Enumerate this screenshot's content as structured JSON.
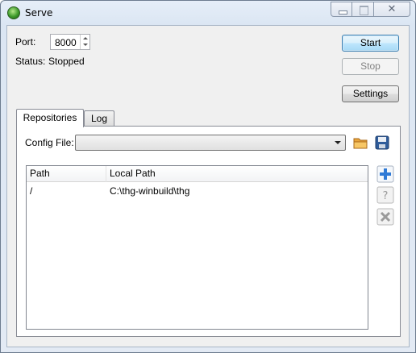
{
  "window": {
    "title": "Serve"
  },
  "server": {
    "port_label": "Port:",
    "port_value": "8000",
    "status_label": "Status:",
    "status_value": "Stopped"
  },
  "buttons": {
    "start": "Start",
    "stop": "Stop",
    "settings": "Settings"
  },
  "tabs": [
    {
      "label": "Repositories",
      "active": true
    },
    {
      "label": "Log",
      "active": false
    }
  ],
  "repositories": {
    "config_file_label": "Config File:",
    "config_file_value": "",
    "columns": [
      "Path",
      "Local Path"
    ],
    "rows": [
      {
        "path": "/",
        "local_path": "C:\\thg-winbuild\\thg"
      }
    ]
  },
  "icons": {
    "open": "folder-icon",
    "save": "save-icon",
    "add": "add-icon",
    "help": "help-icon",
    "remove": "remove-icon"
  },
  "colors": {
    "primary_button_border": "#3c7fb1",
    "add_icon": "#2f7ad6"
  }
}
